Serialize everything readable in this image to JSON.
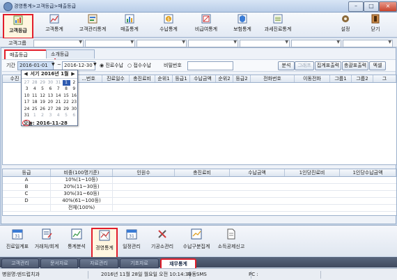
{
  "window": {
    "title": "경영통계>고객등급>매출등급",
    "btn_min": "–",
    "btn_max": "□",
    "btn_close": "×"
  },
  "toolbar": [
    {
      "label": "고객등급",
      "icon": "customer-grade-icon"
    },
    {
      "label": "고객통계",
      "icon": "customer-stats-icon"
    },
    {
      "label": "고객관리통계",
      "icon": "customer-mgmt-stats-icon"
    },
    {
      "label": "매출통계",
      "icon": "sales-stats-icon"
    },
    {
      "label": "수납통계",
      "icon": "payment-stats-icon"
    },
    {
      "label": "비급여통계",
      "icon": "nonbenefit-stats-icon"
    },
    {
      "label": "보험통계",
      "icon": "insurance-stats-icon"
    },
    {
      "label": "과세진료통계",
      "icon": "taxable-stats-icon"
    },
    {
      "label": "설정",
      "icon": "settings-icon"
    },
    {
      "label": "닫기",
      "icon": "close-icon"
    }
  ],
  "customer_group": {
    "label": "고객그룹"
  },
  "tabs": [
    "매출등급",
    "소개등급"
  ],
  "filter": {
    "period_label": "기간",
    "date_from": "2016-01-01",
    "tilde": "~",
    "date_to": "2016-12-30",
    "radio_treatment": "진료수납",
    "radio_receipt": "접수수납",
    "chart_no_label": "비밀번호",
    "buttons": [
      "분석",
      "그래프",
      "집계표출력",
      "총괄표출력",
      "엑셀"
    ]
  },
  "result_grid": {
    "columns": [
      "수진",
      "...번호",
      "진료일수",
      "총진료비",
      "순위1",
      "등급1",
      "수납금액",
      "순위2",
      "등급2",
      "전화번호",
      "이동전화",
      "그룹1",
      "그룹2",
      "그"
    ]
  },
  "calendar": {
    "title": "서기 2016년 1월",
    "prev": "◀",
    "next": "▶",
    "weeks": [
      [
        "27",
        "28",
        "29",
        "30",
        "31",
        "1",
        "2"
      ],
      [
        "3",
        "4",
        "5",
        "6",
        "7",
        "8",
        "9"
      ],
      [
        "10",
        "11",
        "12",
        "13",
        "14",
        "15",
        "16"
      ],
      [
        "17",
        "18",
        "19",
        "20",
        "21",
        "22",
        "23"
      ],
      [
        "24",
        "25",
        "26",
        "27",
        "28",
        "29",
        "30"
      ],
      [
        "31",
        "1",
        "2",
        "3",
        "4",
        "5",
        "6"
      ]
    ],
    "selected_day": "1",
    "today_label": "오늘: 2016-11-28"
  },
  "grade_grid": {
    "columns": [
      "등급",
      "비중(100명기준)",
      "인원수",
      "총진료비",
      "수납금액",
      "1인당진료비",
      "1인당수납금액"
    ],
    "rows": [
      [
        "A",
        "10%(1~10등)"
      ],
      [
        "B",
        "20%(11~30등)"
      ],
      [
        "C",
        "30%(31~60등)"
      ],
      [
        "D",
        "40%(61~100등)"
      ],
      [
        "",
        "전체(100%)"
      ]
    ]
  },
  "launcher": [
    {
      "label": "진료일계표",
      "icon": "calendar-31-icon"
    },
    {
      "label": "거래처/회계",
      "icon": "ledger-icon"
    },
    {
      "label": "통계분석",
      "icon": "analysis-chart-icon"
    },
    {
      "label": "경영통계",
      "icon": "management-stats-icon"
    },
    {
      "label": "일정관리",
      "icon": "schedule-icon"
    },
    {
      "label": "기공소관리",
      "icon": "lab-tools-icon"
    },
    {
      "label": "수납구분집계",
      "icon": "payment-summary-icon"
    },
    {
      "label": "소득공제신고",
      "icon": "tax-document-icon"
    }
  ],
  "bottom_tabs": [
    "고객관리",
    "문서자료",
    "자료관리",
    "기초자료",
    "재무통계"
  ],
  "status": {
    "clinic": "병원명:덴드럽치과",
    "datetime": "2016년 11월 28일 월요일 오전 10:14:39",
    "sms": "자동SMS",
    "pc": "PC :"
  },
  "colors": {
    "highlight": "#e21d2a",
    "selected_day": "#2f5bb0"
  }
}
